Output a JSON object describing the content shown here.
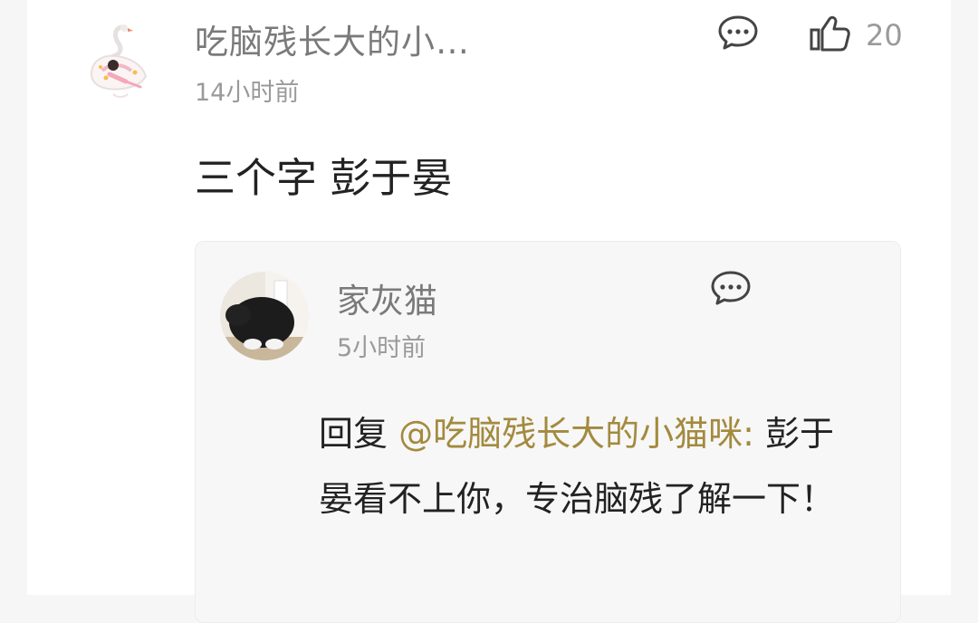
{
  "comment": {
    "author": "吃脑残长大的小…",
    "time": "14小时前",
    "text": "三个字 彭于晏",
    "like_count": "20"
  },
  "reply": {
    "author": "家灰猫",
    "time": "5小时前",
    "prefix": "回复 ",
    "mention": "@吃脑残长大的小猫咪:",
    "text": " 彭于晏看不上你，专治脑残了解一下！"
  },
  "colors": {
    "background": "#f6f6f6",
    "card": "#ffffff",
    "reply_box": "#f7f7f7",
    "mention": "#a38a3e",
    "meta_text": "#9a9a9a"
  },
  "icons": [
    "swan-avatar",
    "comment-icon",
    "thumbs-up-icon",
    "cat-avatar"
  ]
}
